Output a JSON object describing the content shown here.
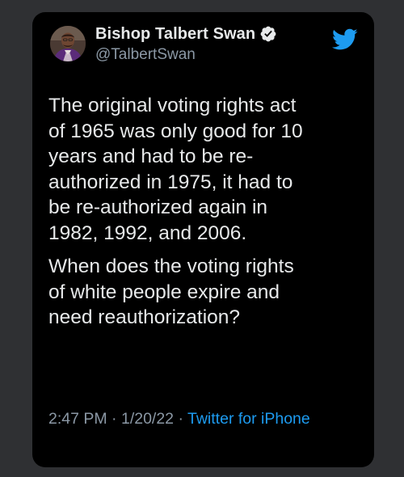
{
  "tweet": {
    "display_name": "Bishop Talbert Swan",
    "handle": "@TalbertSwan",
    "verified": true,
    "paragraphs": [
      "The original voting rights act\nof 1965 was only good for 10\nyears and had to be re-\nauthorized in 1975, it had to\nbe re-authorized again in\n1982, 1992, and 2006.",
      "When does the voting rights\nof white people expire and\nneed reauthorization?"
    ],
    "time": "2:47 PM",
    "separator": " · ",
    "date": "1/20/22",
    "source": "Twitter for iPhone"
  },
  "icons": {
    "avatar": "avatar",
    "verified": "verified-badge-icon",
    "logo": "twitter-bird-icon"
  },
  "colors": {
    "background": "#2f3033",
    "card": "#000000",
    "text": "#e7e9ea",
    "secondary": "#8b98a5",
    "accent": "#1d9bf0"
  }
}
